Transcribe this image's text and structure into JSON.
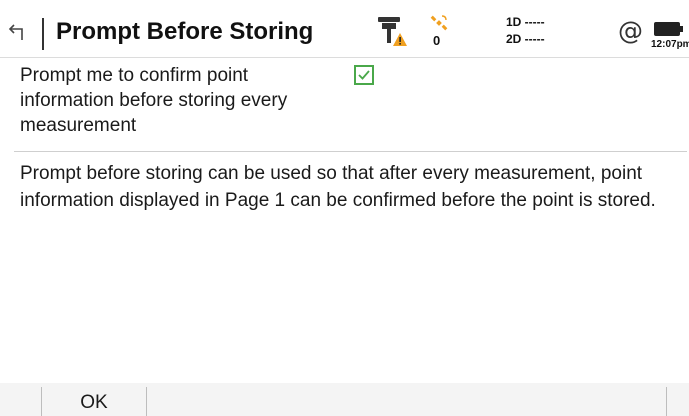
{
  "header": {
    "title": "Prompt Before Storing",
    "satellite_count": "0",
    "distance_1d": "1D -----",
    "distance_2d": "2D -----",
    "at_symbol": "@",
    "clock": "12:07pm"
  },
  "setting": {
    "label": "Prompt me to confirm point information before storing every measurement",
    "checked": true
  },
  "description": "Prompt before storing can be used so that after every measurement, point information displayed in Page 1 can be confirmed before the point is stored.",
  "footer": {
    "ok_label": "OK"
  },
  "colors": {
    "checkbox_accent": "#4aa84a",
    "warning_orange": "#f0a020"
  },
  "icons": {
    "back": "back-arrow-icon",
    "gnss": "gnss-receiver-warning-icon",
    "satellite": "satellite-icon",
    "internet": "at-icon",
    "battery": "battery-icon"
  }
}
